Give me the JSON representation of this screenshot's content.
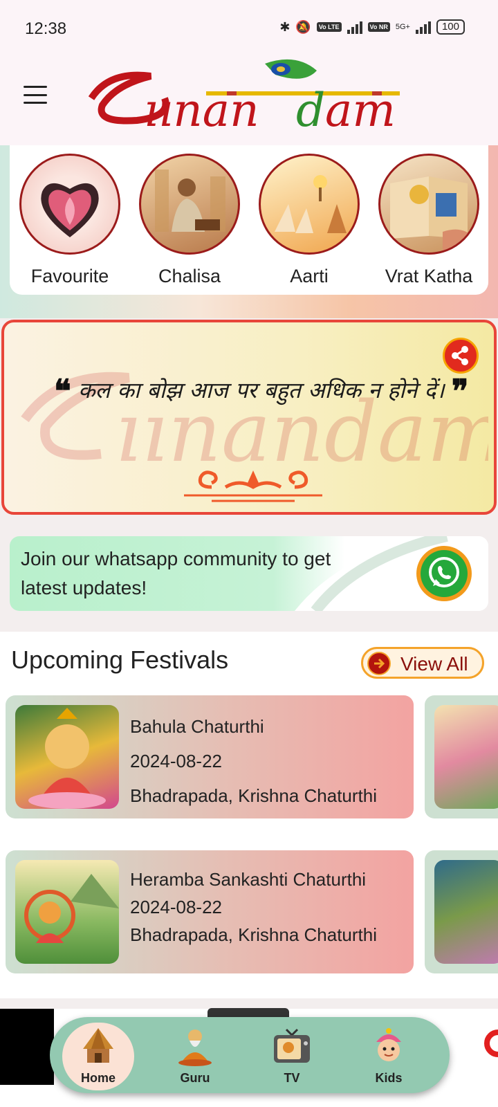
{
  "status_bar": {
    "time": "12:38",
    "battery": "100",
    "lte_tag": "Vo LTE",
    "nr_tag": "Vo NR",
    "network": "5G+"
  },
  "header": {
    "logo_text": "Bhanandam"
  },
  "categories": [
    {
      "label": "Favourite",
      "icon": "lotus-heart-icon"
    },
    {
      "label": "Chalisa",
      "icon": "sage-reading-icon"
    },
    {
      "label": "Aarti",
      "icon": "aarti-lamp-icon"
    },
    {
      "label": "Vrat Katha",
      "icon": "scripture-book-icon"
    }
  ],
  "quote": {
    "text": "कल का बोझ आज पर बहुत अधिक न होने दें।",
    "open_mark": "❝",
    "close_mark": "❞"
  },
  "whatsapp": {
    "text": "Join our whatsapp community to get latest updates!"
  },
  "festivals": {
    "title": "Upcoming Festivals",
    "view_all": "View All",
    "items": [
      {
        "name": "Bahula Chaturthi",
        "date": "2024-08-22",
        "tithi": "Bhadrapada, Krishna Chaturthi"
      },
      {
        "name": "Heramba Sankashti Chaturthi",
        "date": "2024-08-22",
        "tithi": "Bhadrapada, Krishna Chaturthi"
      }
    ]
  },
  "bottom_nav": [
    {
      "label": "Home",
      "icon": "temple-hut-icon",
      "active": true
    },
    {
      "label": "Guru",
      "icon": "guru-icon",
      "active": false
    },
    {
      "label": "TV",
      "icon": "tv-icon",
      "active": false
    },
    {
      "label": "Kids",
      "icon": "kids-icon",
      "active": false
    }
  ],
  "colors": {
    "brand_red": "#9b1b1b",
    "accent_orange": "#f4a32a",
    "nav_green": "#93c9b1",
    "whatsapp_green": "#25a83b"
  }
}
